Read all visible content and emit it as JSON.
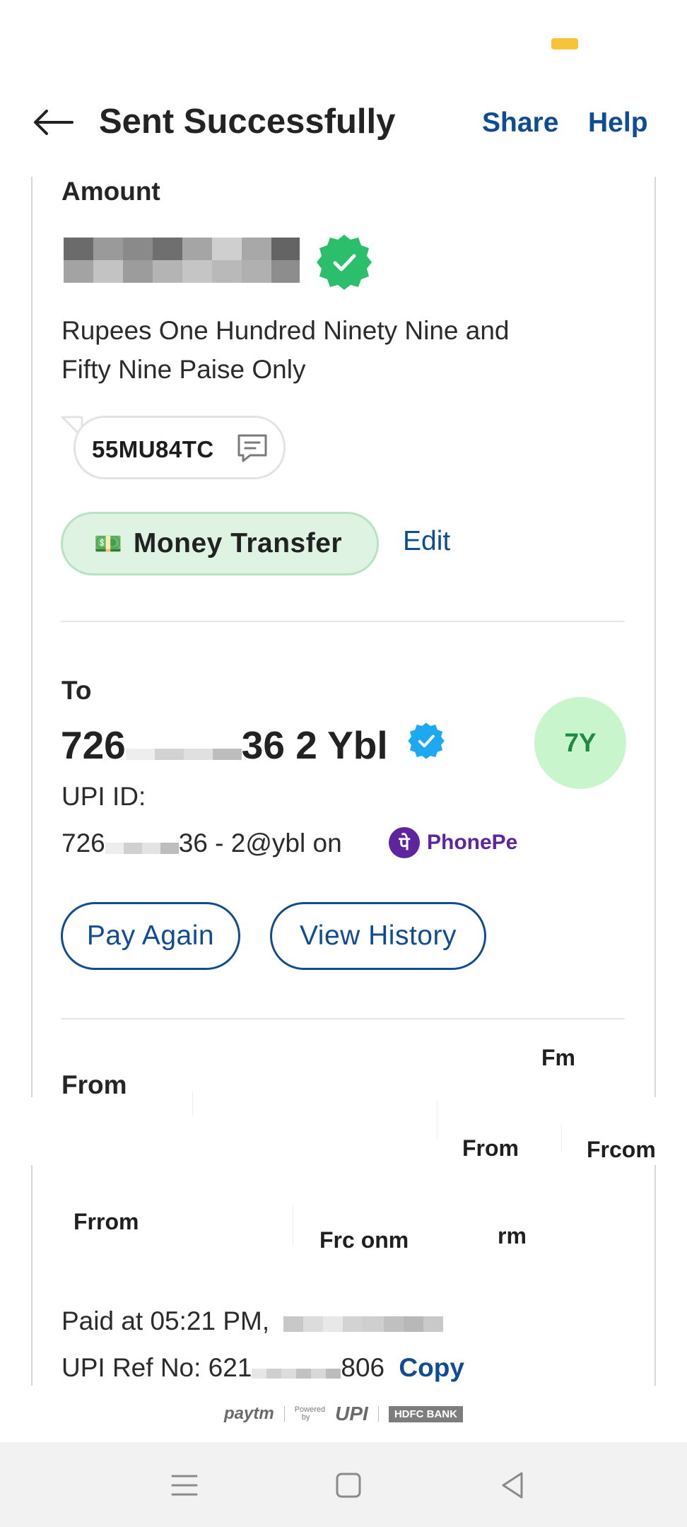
{
  "header": {
    "title": "Sent Successfully",
    "share_label": "Share",
    "help_label": "Help",
    "back_icon": "back-arrow-icon"
  },
  "amount": {
    "label": "Amount",
    "value_hidden": true,
    "in_words": "Rupees One Hundred Ninety Nine and Fifty Nine Paise Only",
    "note": "55MU84TC",
    "category_icon": "💵",
    "category": "Money Transfer",
    "edit_label": "Edit"
  },
  "to": {
    "label": "To",
    "name_prefix": "726",
    "name_suffix": "36 2 Ybl",
    "avatar_initials": "7Y",
    "upi_label": "UPI ID:",
    "upi_prefix": "726",
    "upi_suffix": "36 - 2@ybl on",
    "app_name": "PhonePe",
    "app_logo_glyph": "पे",
    "pay_again_label": "Pay Again",
    "view_history_label": "View History"
  },
  "from": {
    "label": "From",
    "glitch_texts": [
      "Fm",
      "From",
      "Frcom",
      "Frrom",
      "Frc onm",
      "rm"
    ]
  },
  "details": {
    "paid_at_prefix": "Paid at 05:21 PM,",
    "ref_prefix": "UPI Ref No: 621",
    "ref_suffix": "806",
    "copy_label": "Copy"
  },
  "footer": {
    "paytm": "paytm",
    "powered": "Powered",
    "by": "by",
    "upi": "UPI",
    "hdfc": "HDFC BANK"
  },
  "colors": {
    "accent": "#0f4c93",
    "success": "#2bbf6b",
    "category_bg": "#dff3e3",
    "avatar_bg": "#c9f5cc",
    "phonepe": "#5f259f",
    "status_pill": "#f5c438"
  }
}
